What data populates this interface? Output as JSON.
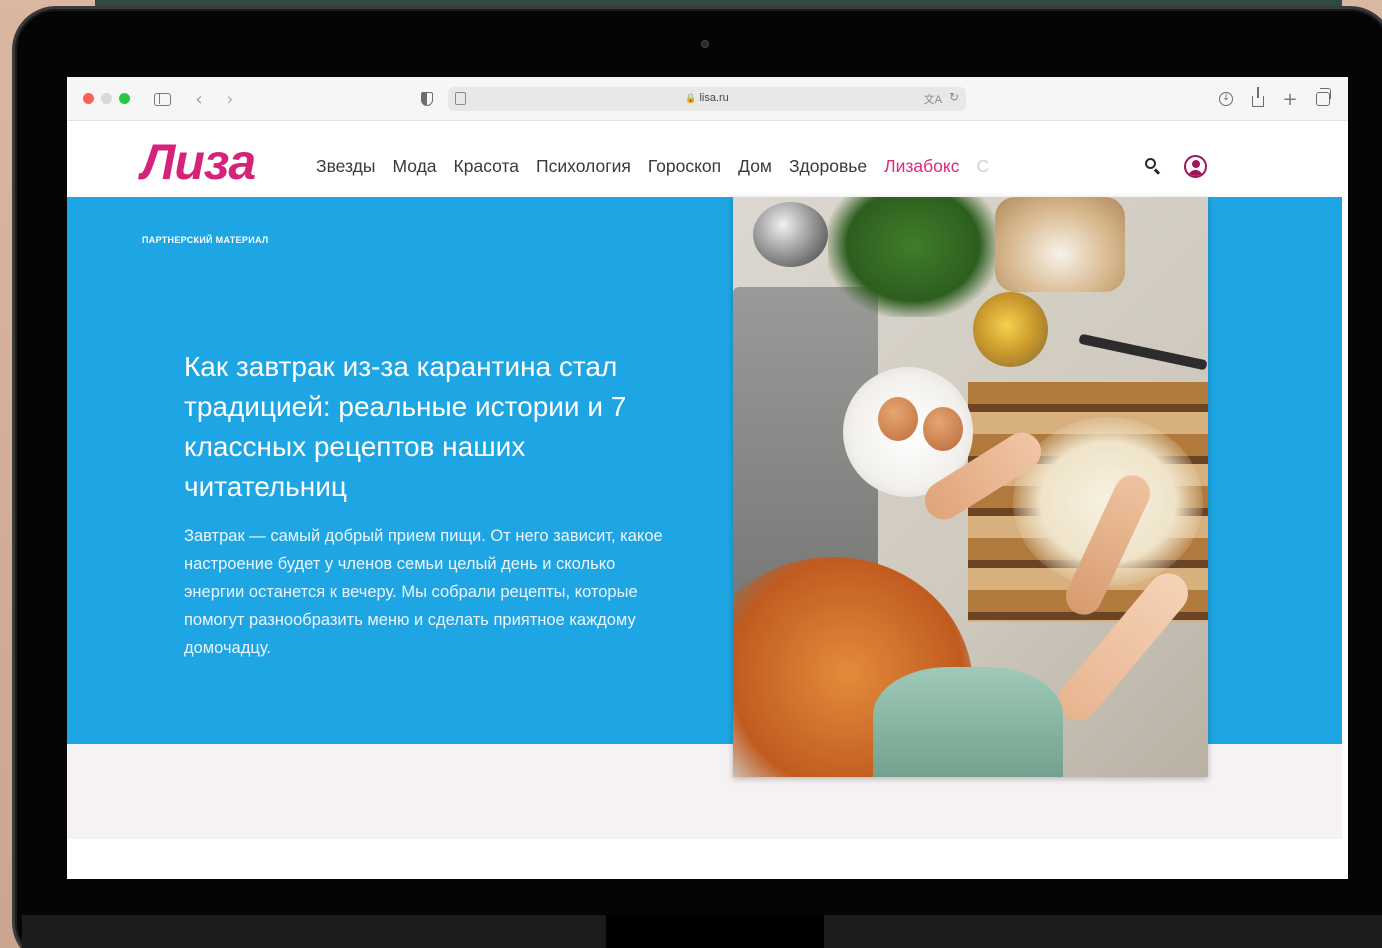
{
  "browser": {
    "url": "lisa.ru"
  },
  "site": {
    "logo": "Лиза",
    "nav": [
      "Звезды",
      "Мода",
      "Красота",
      "Психология",
      "Гороскоп",
      "Дом",
      "Здоровье"
    ],
    "nav_accent": "Лизабокс",
    "nav_faded": "С"
  },
  "article": {
    "label": "ПАРТНЕРСКИЙ МАТЕРИАЛ",
    "title": "Как завтрак из-за карантина стал традицией: реальные истории и 7 классных рецептов наших читательниц",
    "lead": "Завтрак — самый добрый прием пищи. От него зависит, какое настроение будет у членов семьи целый день и сколько энергии останется к вечеру. Мы собрали рецепты, которые помогут разнообразить меню и сделать приятное каждому домочадцу."
  },
  "colors": {
    "brand": "#d6237a",
    "hero_bg": "#1ea6e4",
    "accent_nav": "#e0277e"
  },
  "icons": [
    "sidebar-toggle-icon",
    "back-icon",
    "forward-icon",
    "shield-icon",
    "reader-icon",
    "lock-icon",
    "translate-icon",
    "reload-icon",
    "download-icon",
    "share-icon",
    "new-tab-icon",
    "tabs-overview-icon",
    "search-icon",
    "user-icon"
  ]
}
